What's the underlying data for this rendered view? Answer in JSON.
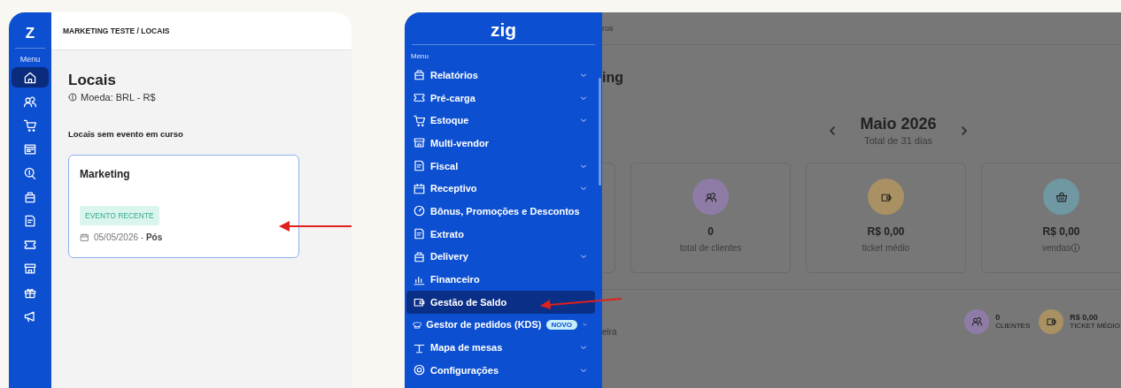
{
  "left_window": {
    "logo": "Z",
    "rail_label": "Menu",
    "rail_items": [
      {
        "selected": true
      },
      {
        "selected": false
      },
      {
        "selected": false
      },
      {
        "selected": false
      },
      {
        "selected": false
      },
      {
        "selected": false
      },
      {
        "selected": false
      },
      {
        "selected": false
      },
      {
        "selected": false
      },
      {
        "selected": false
      },
      {
        "selected": false
      }
    ],
    "breadcrumb": "MARKETING TESTE / LOCAIS",
    "title": "Locais",
    "currency": "Moeda: BRL - R$",
    "section_title": "Locais sem evento em curso",
    "venues": [
      {
        "name": "Marketing",
        "badge": "EVENTO RECENTE",
        "date": "05/05/2026 - **Pós**"
      }
    ]
  },
  "right_window": {
    "logo": "zig",
    "menu_label": "Menu",
    "menu_items": [
      {
        "label": "Relatórios",
        "expandable": true,
        "selected": false
      },
      {
        "label": "Pré-carga",
        "expandable": true,
        "selected": false
      },
      {
        "label": "Estoque",
        "expandable": true,
        "selected": false
      },
      {
        "label": "Multi-vendor",
        "expandable": false,
        "selected": false
      },
      {
        "label": "Fiscal",
        "expandable": true,
        "selected": false
      },
      {
        "label": "Receptivo",
        "expandable": true,
        "selected": false
      },
      {
        "label": "Bônus, Promoções e Descontos",
        "expandable": false,
        "selected": false
      },
      {
        "label": "Extrato",
        "expandable": false,
        "selected": false
      },
      {
        "label": "Delivery",
        "expandable": true,
        "selected": false
      },
      {
        "label": "Financeiro",
        "expandable": false,
        "selected": false
      },
      {
        "label": "Gestão de Saldo",
        "expandable": false,
        "selected": true
      },
      {
        "label": "Gestor de pedidos (KDS)",
        "badge": "NOVO",
        "expandable": true,
        "selected": false
      },
      {
        "label": "Mapa de mesas",
        "expandable": true,
        "selected": false
      },
      {
        "label": "Configurações",
        "expandable": true,
        "selected": false
      }
    ],
    "background": {
      "breadcrumb": "ros",
      "title": "ing",
      "month": "Maio 2026",
      "month_subtitle": "Total de 31 dias",
      "stats": [
        {
          "value": "0",
          "label": "total de clientes",
          "color": "#8e7ca6"
        },
        {
          "value": "R$ 0,00",
          "label": "ticket médio",
          "color": "#a99163"
        },
        {
          "value": "R$ 0,00",
          "label": "vendas",
          "color": "#6f98a3"
        }
      ],
      "section_fragment": "eira",
      "summary": [
        {
          "value": "0",
          "label": "CLIENTES",
          "color": "#8e7ca6"
        },
        {
          "value": "R$ 0,00",
          "label": "TICKET MÉDIO",
          "color": "#a99163"
        }
      ]
    }
  }
}
